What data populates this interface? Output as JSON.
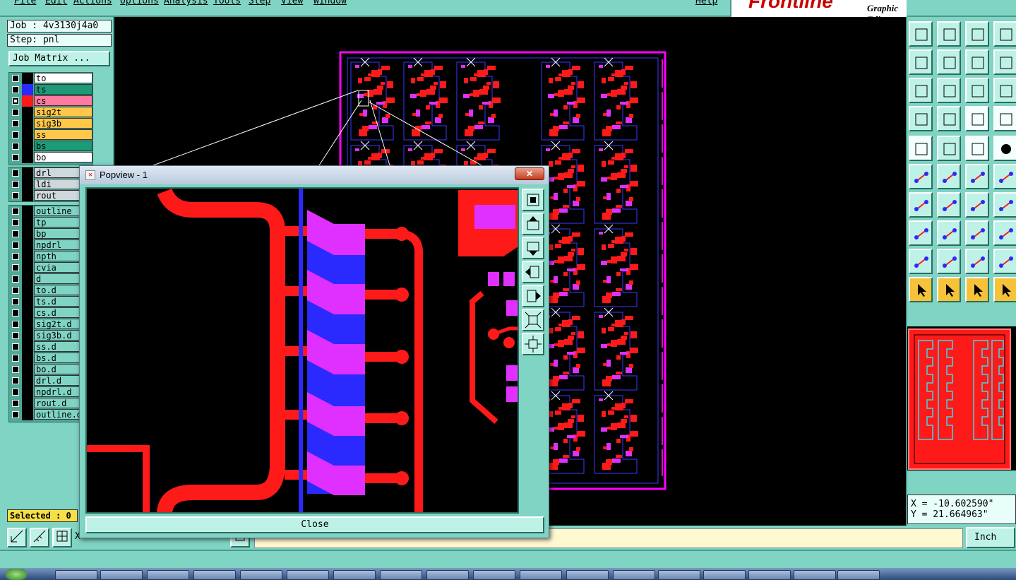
{
  "menubar": {
    "items": [
      "File",
      "Edit",
      "Actions",
      "Options",
      "Analysis",
      "Tools",
      "Step",
      "View",
      "Window"
    ],
    "help": "Help",
    "brand": "Frontline",
    "brand_sub": "Graphic Editor"
  },
  "job": {
    "job_line": "Job : 4v3130j4a0",
    "step_line": "Step: pnl",
    "matrix_button": "Job Matrix ..."
  },
  "layers": {
    "board": [
      {
        "name": "to",
        "color": "#ffffff",
        "swatch": "#000000",
        "checked": false
      },
      {
        "name": "ts",
        "color": "#1d9a78",
        "swatch": "#2a2aff",
        "checked": false
      },
      {
        "name": "cs",
        "color": "#ff7aa0",
        "swatch": "#ff1a1a",
        "checked": true
      },
      {
        "name": "sig2t",
        "color": "#ffc84a",
        "swatch": "#000000",
        "checked": false
      },
      {
        "name": "sig3b",
        "color": "#ffc84a",
        "swatch": "#000000",
        "checked": false
      },
      {
        "name": "ss",
        "color": "#ffc84a",
        "swatch": "#000000",
        "checked": false
      },
      {
        "name": "bs",
        "color": "#1d9a78",
        "swatch": "#000000",
        "checked": false
      },
      {
        "name": "bo",
        "color": "#ffffff",
        "swatch": "#000000",
        "checked": false
      }
    ],
    "drill": [
      {
        "name": "drl",
        "color": "#cfd8dc",
        "swatch": "#000000",
        "checked": false
      },
      {
        "name": "ldi",
        "color": "#cfd8dc",
        "swatch": "#000000",
        "checked": false
      },
      {
        "name": "rout",
        "color": "#cfd8dc",
        "swatch": "#000000",
        "checked": false
      }
    ],
    "misc": [
      {
        "name": "outline",
        "color": "#7fd4c4",
        "swatch": "#000000",
        "checked": false
      },
      {
        "name": "tp",
        "color": "#7fd4c4",
        "swatch": "#000000",
        "checked": false
      },
      {
        "name": "bp",
        "color": "#7fd4c4",
        "swatch": "#000000",
        "checked": false
      },
      {
        "name": "npdrl",
        "color": "#7fd4c4",
        "swatch": "#000000",
        "checked": false
      },
      {
        "name": "npth",
        "color": "#7fd4c4",
        "swatch": "#000000",
        "checked": false
      },
      {
        "name": "cvia",
        "color": "#7fd4c4",
        "swatch": "#000000",
        "checked": false
      },
      {
        "name": "d",
        "color": "#7fd4c4",
        "swatch": "#000000",
        "checked": false
      },
      {
        "name": "to.d",
        "color": "#7fd4c4",
        "swatch": "#000000",
        "checked": false
      },
      {
        "name": "ts.d",
        "color": "#7fd4c4",
        "swatch": "#000000",
        "checked": false
      },
      {
        "name": "cs.d",
        "color": "#7fd4c4",
        "swatch": "#000000",
        "checked": false
      },
      {
        "name": "sig2t.d",
        "color": "#7fd4c4",
        "swatch": "#000000",
        "checked": false
      },
      {
        "name": "sig3b.d",
        "color": "#7fd4c4",
        "swatch": "#000000",
        "checked": false
      },
      {
        "name": "ss.d",
        "color": "#7fd4c4",
        "swatch": "#000000",
        "checked": false
      },
      {
        "name": "bs.d",
        "color": "#7fd4c4",
        "swatch": "#000000",
        "checked": false
      },
      {
        "name": "bo.d",
        "color": "#7fd4c4",
        "swatch": "#000000",
        "checked": false
      },
      {
        "name": "drl.d",
        "color": "#7fd4c4",
        "swatch": "#000000",
        "checked": false
      },
      {
        "name": "npdrl.d",
        "color": "#7fd4c4",
        "swatch": "#000000",
        "checked": false
      },
      {
        "name": "rout.d",
        "color": "#7fd4c4",
        "swatch": "#000000",
        "checked": false
      },
      {
        "name": "outline.d",
        "color": "#7fd4c4",
        "swatch": "#000000",
        "checked": false
      }
    ]
  },
  "status": {
    "selected": "Selected : 0",
    "x_label": "X",
    "units": "Inch"
  },
  "coords": {
    "x": "X = -10.602590\"",
    "y": "Y = 21.664963\""
  },
  "popview": {
    "title": "Popview - 1",
    "close_x": "✕",
    "close_button": "Close"
  },
  "colors": {
    "teal": "#7fd4c4",
    "copper_red": "#ff1a1a",
    "pad_magenta": "#e030ff",
    "blue_layer": "#2a2aff",
    "board_outline": "#ff00ff"
  }
}
